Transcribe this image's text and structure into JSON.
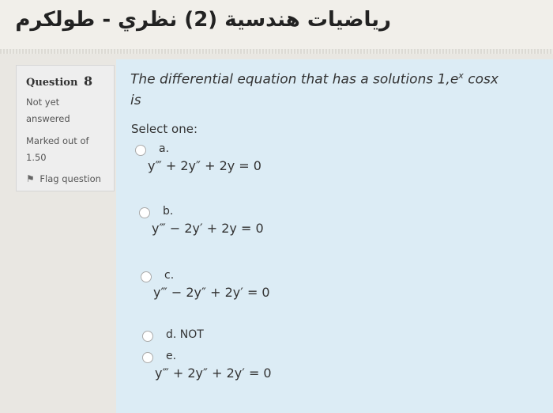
{
  "header": {
    "title": "رياضيات هندسية (2) نظري - طولكرم"
  },
  "info": {
    "question_label": "Question",
    "question_number": "8",
    "state": "Not yet answered",
    "grade": "Marked out of 1.50",
    "flag_label": "Flag question",
    "flag_icon": "flag-icon"
  },
  "question": {
    "text_main": "The differential equation that has a solutions 1,e",
    "text_sup": "x",
    "text_end": " cosx",
    "text_line2": "is",
    "select_prompt": "Select one:"
  },
  "options": [
    {
      "letter": "a.",
      "equation": "y‴ + 2y″ + 2y = 0"
    },
    {
      "letter": "b.",
      "equation": "y‴ − 2y′ + 2y = 0"
    },
    {
      "letter": "c.",
      "equation": "y‴ − 2y″ + 2y′ = 0"
    },
    {
      "letter": "d. NOT",
      "equation": ""
    },
    {
      "letter": "e.",
      "equation": "y‴ + 2y″ + 2y′ = 0"
    }
  ]
}
